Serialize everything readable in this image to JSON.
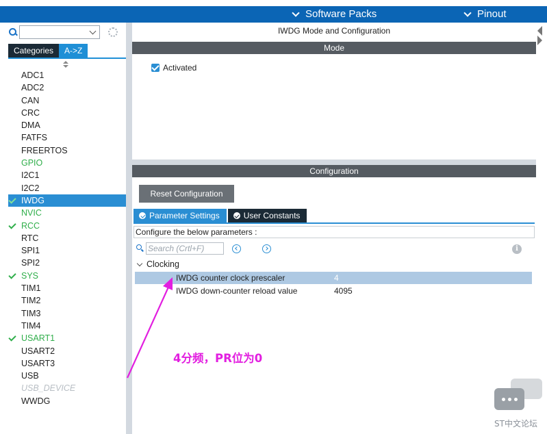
{
  "topbar": {
    "software_packs": "Software Packs",
    "pinout": "Pinout"
  },
  "sidebar": {
    "search_value": "",
    "tabs": [
      {
        "label": "Categories"
      },
      {
        "label": "A->Z"
      }
    ],
    "items": [
      {
        "label": "ADC1",
        "state": "normal"
      },
      {
        "label": "ADC2",
        "state": "normal"
      },
      {
        "label": "CAN",
        "state": "normal"
      },
      {
        "label": "CRC",
        "state": "normal"
      },
      {
        "label": "DMA",
        "state": "normal"
      },
      {
        "label": "FATFS",
        "state": "normal"
      },
      {
        "label": "FREERTOS",
        "state": "normal"
      },
      {
        "label": "GPIO",
        "state": "green"
      },
      {
        "label": "I2C1",
        "state": "normal"
      },
      {
        "label": "I2C2",
        "state": "normal"
      },
      {
        "label": "IWDG",
        "state": "selected-checked"
      },
      {
        "label": "NVIC",
        "state": "green"
      },
      {
        "label": "RCC",
        "state": "green-checked"
      },
      {
        "label": "RTC",
        "state": "normal"
      },
      {
        "label": "SPI1",
        "state": "normal"
      },
      {
        "label": "SPI2",
        "state": "normal"
      },
      {
        "label": "SYS",
        "state": "green-checked"
      },
      {
        "label": "TIM1",
        "state": "normal"
      },
      {
        "label": "TIM2",
        "state": "normal"
      },
      {
        "label": "TIM3",
        "state": "normal"
      },
      {
        "label": "TIM4",
        "state": "normal"
      },
      {
        "label": "USART1",
        "state": "green-checked"
      },
      {
        "label": "USART2",
        "state": "normal"
      },
      {
        "label": "USART3",
        "state": "normal"
      },
      {
        "label": "USB",
        "state": "normal"
      },
      {
        "label": "USB_DEVICE",
        "state": "disabled"
      },
      {
        "label": "WWDG",
        "state": "normal"
      }
    ]
  },
  "main": {
    "title": "IWDG Mode and Configuration",
    "mode_header": "Mode",
    "activated_label": "Activated",
    "activated_checked": true,
    "config_header": "Configuration",
    "reset_button": "Reset Configuration",
    "tabs": [
      {
        "label": "Parameter Settings"
      },
      {
        "label": "User Constants"
      }
    ],
    "hint": "Configure the below parameters :",
    "search_placeholder": "Search (Crtl+F)",
    "group": "Clocking",
    "params": [
      {
        "name": "IWDG counter clock prescaler",
        "value": "4"
      },
      {
        "name": "IWDG down-counter reload value",
        "value": "4095"
      }
    ]
  },
  "annotation": {
    "text": "4分频，PR位为0",
    "color": "#e21fe0"
  },
  "watermark": "ST中文论坛",
  "colors": {
    "accent": "#2a8ed3",
    "topbar": "#0b65b5",
    "green": "#2fae4a",
    "section_header": "#555b61"
  }
}
